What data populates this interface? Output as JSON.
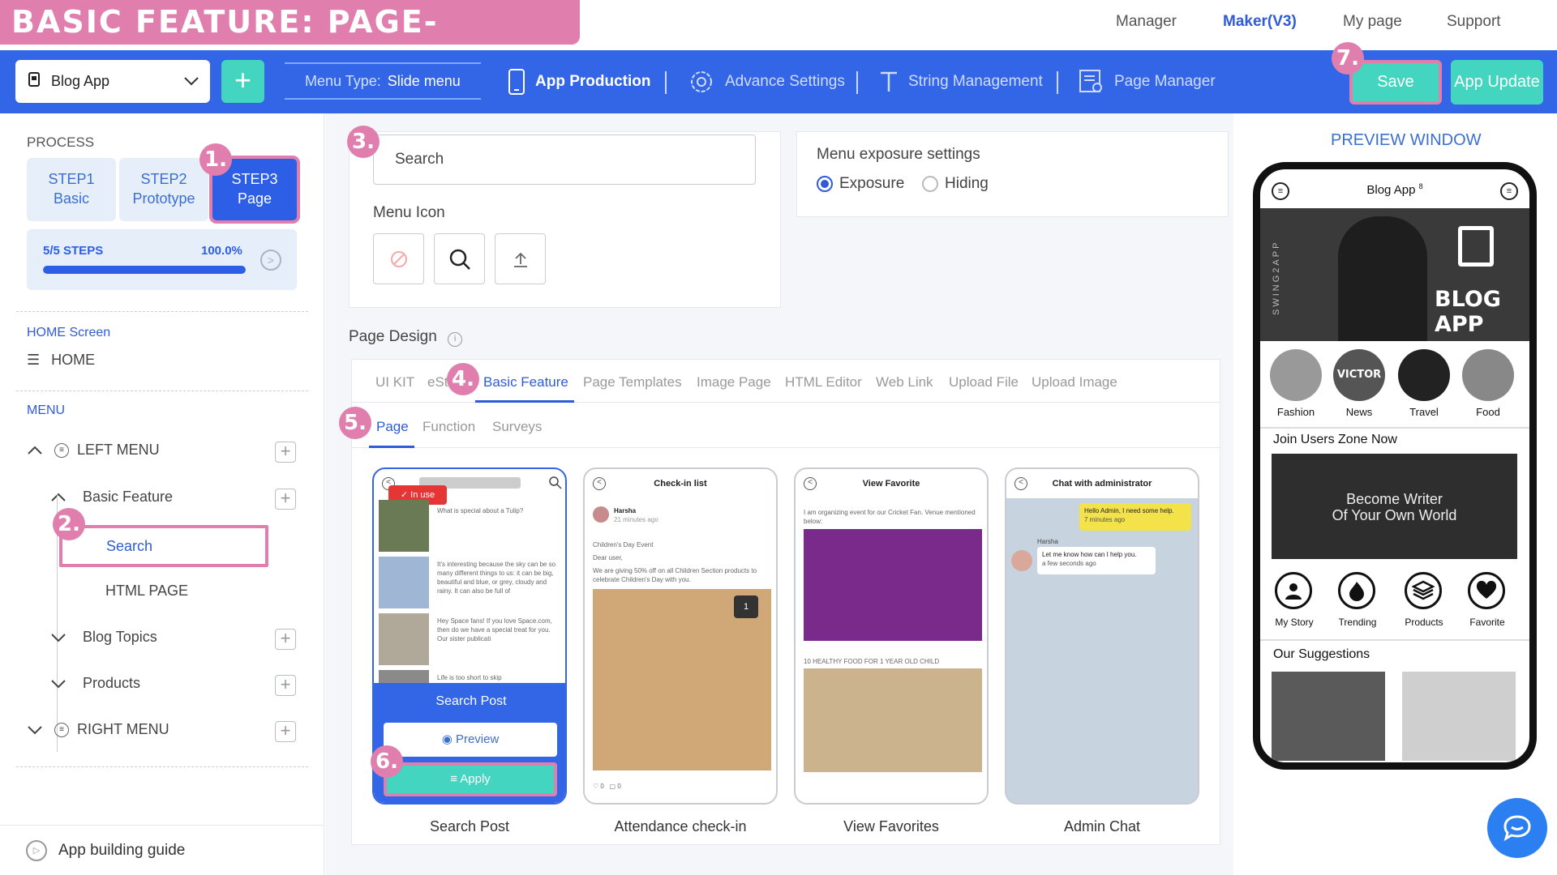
{
  "header": {
    "banner": "BASIC FEATURE: PAGE- SEARCH POST",
    "nav": [
      "Manager",
      "Maker(V3)",
      "My page",
      "Support"
    ]
  },
  "toolbar": {
    "app_name": "Blog App",
    "add_label": "+",
    "menu_type_label": "Menu Type:",
    "menu_type_value": "Slide menu",
    "items": [
      "App Production",
      "Advance Settings",
      "String Management",
      "Page Manager"
    ],
    "save": "Save",
    "update": "App Update"
  },
  "badges": [
    "1.",
    "2.",
    "3.",
    "4.",
    "5.",
    "6.",
    "7."
  ],
  "sidebar": {
    "process_label": "PROCESS",
    "steps": [
      {
        "l1": "STEP1",
        "l2": "Basic"
      },
      {
        "l1": "STEP2",
        "l2": "Prototype"
      },
      {
        "l1": "STEP3",
        "l2": "Page"
      }
    ],
    "progress_label": "5/5 STEPS",
    "progress_pct": "100.0%",
    "progress_value": 1.0,
    "home_screen_label": "HOME Screen",
    "home_item": "HOME",
    "menu_label": "MENU",
    "left_menu": "LEFT MENU",
    "basic_feature": "Basic Feature",
    "search": "Search",
    "html_page": "HTML PAGE",
    "blog_topics": "Blog Topics",
    "products": "Products",
    "right_menu": "RIGHT MENU",
    "guide": "App building guide"
  },
  "main": {
    "search_value": "Search",
    "menu_icon_label": "Menu Icon",
    "exposure_title": "Menu exposure settings",
    "exposure_opts": [
      "Exposure",
      "Hiding"
    ],
    "page_design_label": "Page Design",
    "tabs": [
      "UI KIT",
      "eSt",
      "Basic Feature",
      "Page Templates",
      "Image Page",
      "HTML Editor",
      "Web Link",
      "Upload File",
      "Upload Image"
    ],
    "subtabs": [
      "Page",
      "Function",
      "Surveys"
    ],
    "cards": [
      {
        "title": "Search Post",
        "overlay_title": "Search Post",
        "preview": "Preview",
        "apply": "Apply",
        "in_use": "In use"
      },
      {
        "title": "Attendance check-in",
        "header": "Check-in list"
      },
      {
        "title": "View Favorites",
        "header": "View Favorite"
      },
      {
        "title": "Admin Chat",
        "header": "Chat with administrator"
      }
    ],
    "card1_texts": [
      "What is special about a Tulip?",
      "It's interesting because the sky can be so many different things to us: it can be big, beautiful and blue, or grey, cloudy and rainy. It can also be full of",
      "Hey Space fans! If you love Space.com, then do we have a special treat for you. Our sister publicati",
      "Life is too short to skip"
    ],
    "card2_texts": {
      "name": "Harsha",
      "time": "21 minutes ago",
      "event": "Children's Day Event",
      "dear": "Dear user,",
      "body": "We are giving 50% off on all Children Section products to celebrate Children's Day with you.",
      "count": "1",
      "likes": "0",
      "comments": "0"
    },
    "card3_texts": {
      "top": "I am organizing event for our Cricket Fan. Venue mentioned below:",
      "bottom": "10 HEALTHY FOOD FOR 1 YEAR OLD CHILD"
    },
    "card4_texts": {
      "msg1": "Hello Admin, I need some help.",
      "msg1_time": "7 minutes ago",
      "sender": "Harsha",
      "msg2": "Let me know how can I help you.",
      "msg2_time": "a few seconds ago"
    }
  },
  "preview": {
    "title": "PREVIEW WINDOW",
    "app_title": "Blog App",
    "app_badge": "8",
    "brand_vertical": "SWING2APP",
    "hero_text": "BLOG APP",
    "categories": [
      "Fashion",
      "News",
      "Travel",
      "Food"
    ],
    "news_circle_text": "VICTOR",
    "join_title": "Join Users Zone Now",
    "join_banner": [
      "Become Writer",
      "Of Your Own World"
    ],
    "icons": [
      "My Story",
      "Trending",
      "Products",
      "Favorite"
    ],
    "suggestions_title": "Our Suggestions"
  },
  "colors": {
    "accent_blue": "#3366e6",
    "teal": "#44d5c0",
    "pink": "#e07fad"
  }
}
